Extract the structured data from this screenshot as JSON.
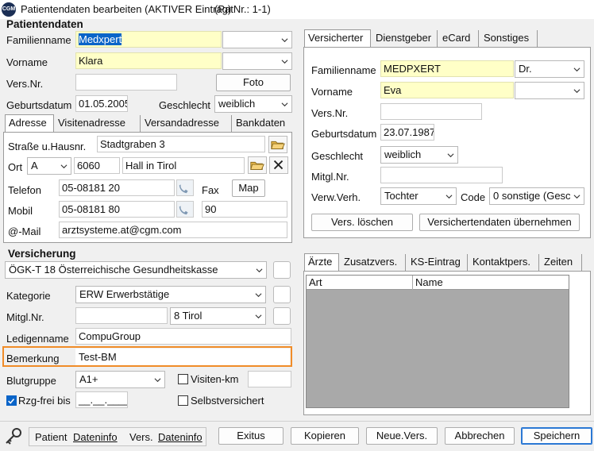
{
  "window": {
    "title": "Patientendaten bearbeiten (AKTIVER Eintrag)",
    "patnr": "(PatNr.: 1-1)",
    "logo": "CGM"
  },
  "patient": {
    "section_title": "Patientendaten",
    "familienname_label": "Familienname",
    "familienname": "Medxpert",
    "familienname_extra": "",
    "vorname_label": "Vorname",
    "vorname": "Klara",
    "vorname_extra": "",
    "versnr_label": "Vers.Nr.",
    "versnr": "",
    "foto_label": "Foto",
    "geburtsdatum_label": "Geburtsdatum",
    "geburtsdatum": "01.05.2005",
    "geschlecht_label": "Geschlecht",
    "geschlecht": "weiblich"
  },
  "address_tabs": [
    "Adresse",
    "Visitenadresse",
    "Versandadresse",
    "Bankdaten"
  ],
  "address": {
    "strasse_label": "Straße u.Hausnr.",
    "strasse": "Stadtgraben 3",
    "ort_label": "Ort",
    "land": "A",
    "plz": "6060",
    "ort": "Hall in Tirol",
    "telefon_label": "Telefon",
    "telefon": "05-08181 20",
    "fax_label": "Fax",
    "map_label": "Map",
    "mobil_label": "Mobil",
    "mobil": "05-08181 80",
    "fax": "90",
    "email_label": "@-Mail",
    "email": "arztsysteme.at@cgm.com"
  },
  "insurance": {
    "section_title": "Versicherung",
    "kasse": "ÖGK-T 18 Österreichische Gesundheitskasse",
    "kategorie_label": "Kategorie",
    "kategorie": "ERW Erwerbstätige",
    "mitglnr_label": "Mitgl.Nr.",
    "mitglnr": "",
    "bundesland": "8 Tirol",
    "ledigenname_label": "Ledigenname",
    "ledigenname": "CompuGroup",
    "bemerkung_label": "Bemerkung",
    "bemerkung": "Test-BM",
    "blutgruppe_label": "Blutgruppe",
    "blutgruppe": "A1+",
    "visiten_label": "Visiten-km",
    "visiten": "",
    "rzg_label": "Rzg-frei bis",
    "rzg": "__.__.____",
    "selbst_label": "Selbstversichert"
  },
  "insured_tabs": [
    "Versicherter",
    "Dienstgeber",
    "eCard",
    "Sonstiges"
  ],
  "insured": {
    "familienname_label": "Familienname",
    "familienname": "MEDPXERT",
    "titel": "Dr.",
    "vorname_label": "Vorname",
    "vorname": "Eva",
    "vorname_extra": "",
    "versnr_label": "Vers.Nr.",
    "versnr": "",
    "geburtsdatum_label": "Geburtsdatum",
    "geburtsdatum": "23.07.1987",
    "geschlecht_label": "Geschlecht",
    "geschlecht": "weiblich",
    "mitglnr_label": "Mitgl.Nr.",
    "mitglnr": "",
    "verw_label": "Verw.Verh.",
    "verw": "Tochter",
    "code_label": "Code",
    "code": "0 sonstige (Gesc",
    "loeschen_label": "Vers. löschen",
    "uebernehmen_label": "Versichertendaten übernehmen"
  },
  "doctor_tabs": [
    "Ärzte",
    "Zusatzvers.",
    "KS-Eintrag",
    "Kontaktpers.",
    "Zeiten"
  ],
  "doctor_table": {
    "columns": [
      "Art",
      "Name"
    ]
  },
  "footer": {
    "patient_label": "Patient",
    "patient_link": "Dateninfo",
    "vers_label": "Vers.",
    "vers_link": "Dateninfo",
    "exitus": "Exitus",
    "kopieren": "Kopieren",
    "neuevers": "Neue.Vers.",
    "abbrechen": "Abbrechen",
    "speichern": "Speichern"
  },
  "colors": {
    "highlight": "#f08c28",
    "accent": "#2b78d4",
    "yellow_field": "#ffffc7"
  }
}
